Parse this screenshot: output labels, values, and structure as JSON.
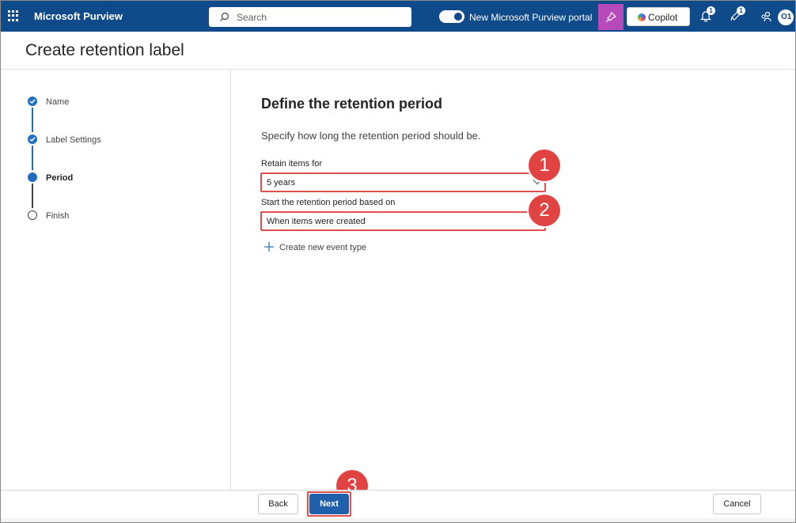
{
  "header": {
    "app_title": "Microsoft Purview",
    "search_placeholder": "Search",
    "portal_toggle_label": "New Microsoft Purview portal",
    "copilot_label": "Copilot",
    "notifications_count": "1",
    "feedback_count": "1",
    "avatar_initials": "O1",
    "brand_color": "#0f4a8a"
  },
  "page": {
    "title": "Create retention label"
  },
  "steps": [
    {
      "label": "Name",
      "state": "done"
    },
    {
      "label": "Label Settings",
      "state": "done"
    },
    {
      "label": "Period",
      "state": "current"
    },
    {
      "label": "Finish",
      "state": "pending"
    }
  ],
  "main": {
    "section_title": "Define the retention period",
    "description": "Specify how long the retention period should be.",
    "retain_label": "Retain items for",
    "retain_value": "5 years",
    "start_label": "Start the retention period based on",
    "start_value": "When items were created",
    "create_event_label": "Create new event type"
  },
  "callouts": [
    "1",
    "2",
    "3"
  ],
  "footer": {
    "back_label": "Back",
    "next_label": "Next",
    "cancel_label": "Cancel"
  }
}
